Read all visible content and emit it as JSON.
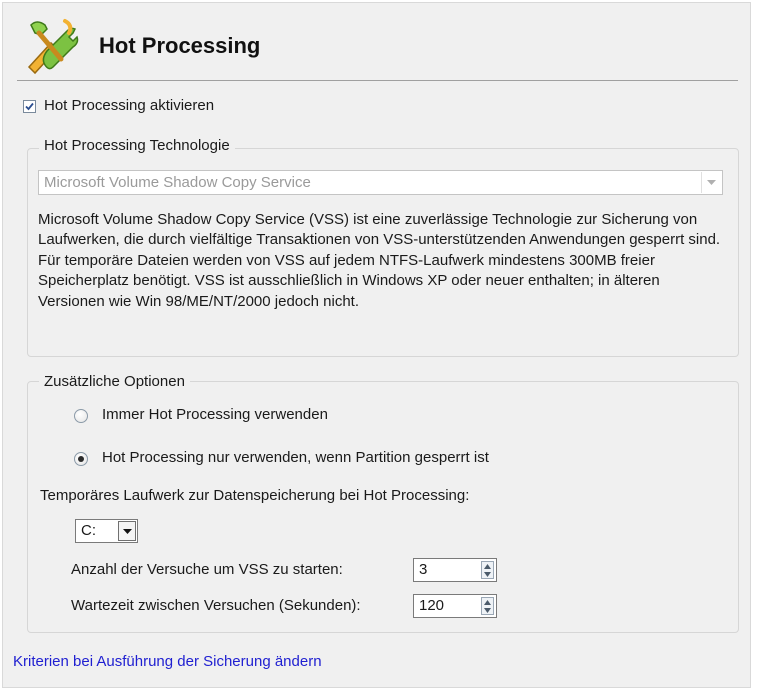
{
  "header": {
    "title": "Hot Processing",
    "icon": "tools-wrench-icon"
  },
  "enable": {
    "label": "Hot Processing aktivieren",
    "checked": true
  },
  "technology": {
    "group_title": "Hot Processing Technologie",
    "selected": "Microsoft Volume Shadow Copy Service",
    "description": "Microsoft Volume Shadow Copy Service (VSS) ist eine zuverlässige Technologie zur Sicherung von Laufwerken, die durch vielfältige Transaktionen von VSS-unterstützenden Anwendungen gesperrt sind. Für temporäre Dateien werden von VSS auf jedem NTFS-Laufwerk mindestens 300MB freier Speicherplatz benötigt. VSS ist ausschließlich in Windows XP oder neuer enthalten; in älteren Versionen wie Win 98/ME/NT/2000 jedoch nicht."
  },
  "options": {
    "group_title": "Zusätzliche Optionen",
    "radio_always": "Immer Hot Processing verwenden",
    "radio_locked": "Hot Processing nur verwenden, wenn Partition gesperrt ist",
    "selected_radio": "radio_locked",
    "temp_drive_label": "Temporäres Laufwerk zur Datenspeicherung bei Hot Processing:",
    "temp_drive_value": "C:",
    "attempts_label": "Anzahl der Versuche um VSS zu starten:",
    "attempts_value": "3",
    "wait_label": "Wartezeit zwischen Versuchen (Sekunden):",
    "wait_value": "120"
  },
  "footer": {
    "link": "Kriterien bei Ausführung der Sicherung ändern"
  },
  "colors": {
    "panel_bg": "#f0f0f0",
    "link": "#1f1fd1",
    "disabled_text": "#9a9a9a"
  }
}
